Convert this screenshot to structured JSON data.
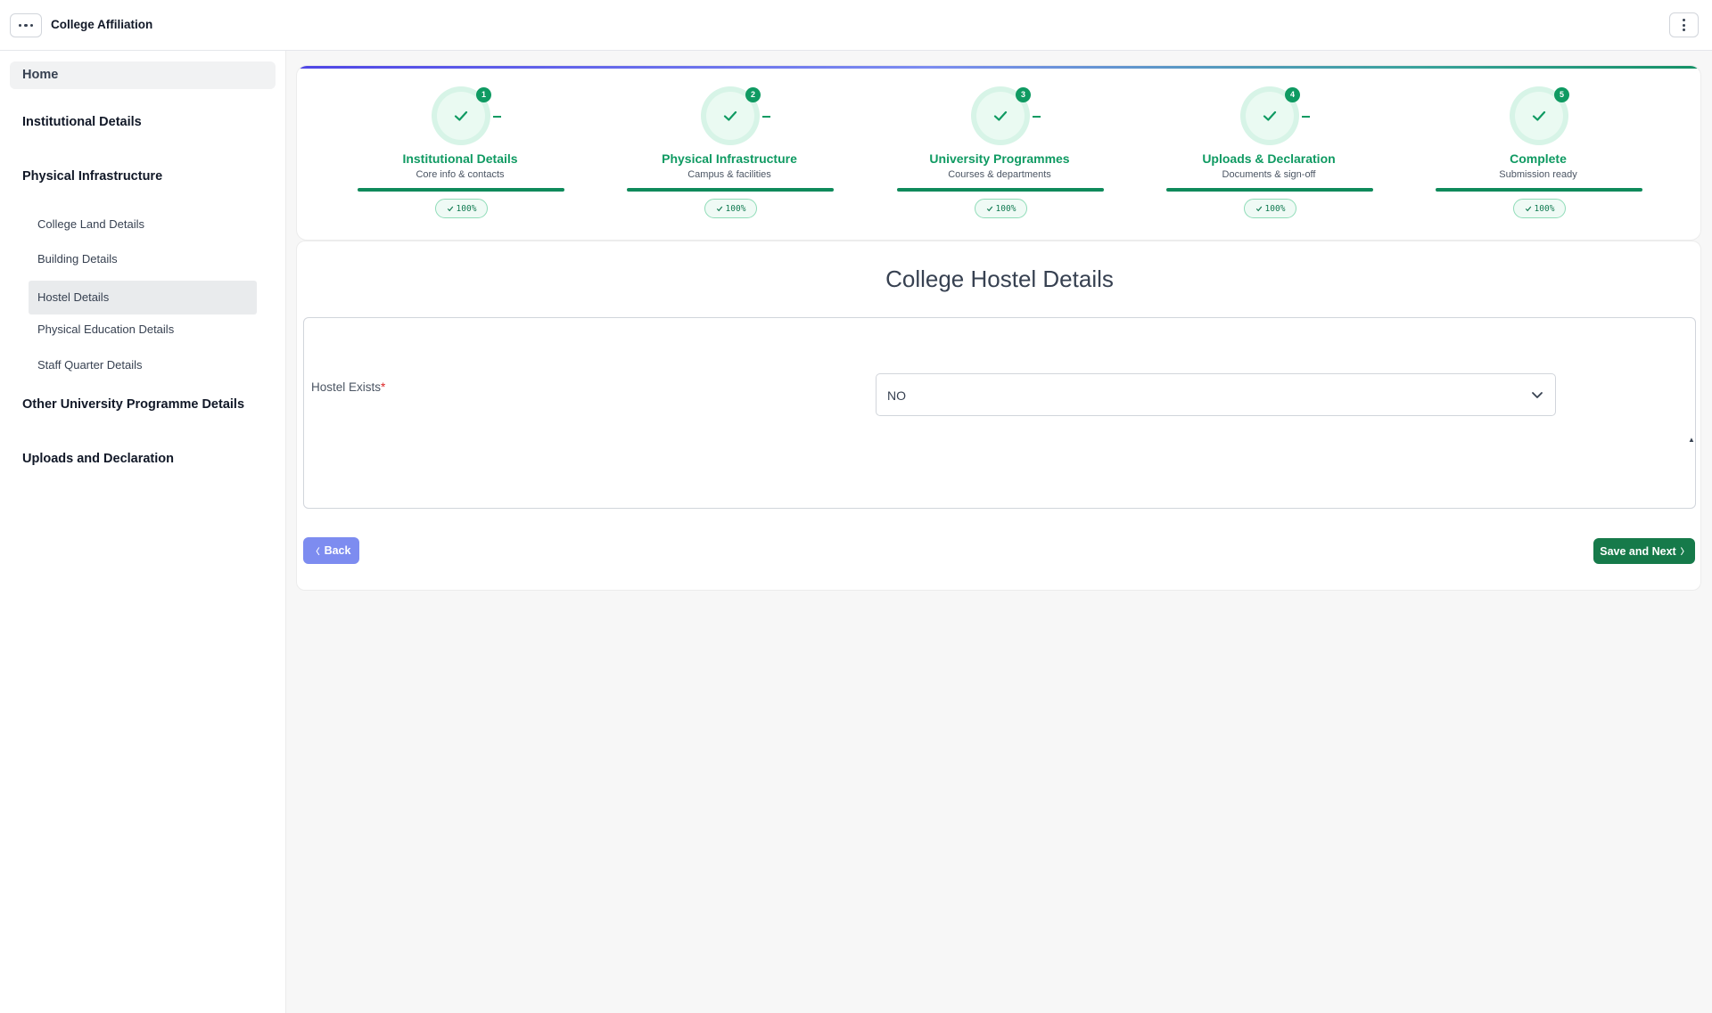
{
  "app": {
    "title": "College Affiliation"
  },
  "sidebar": {
    "home": "Home",
    "sections": [
      {
        "label": "Institutional Details"
      },
      {
        "label": "Physical Infrastructure",
        "items": [
          {
            "label": "College Land Details"
          },
          {
            "label": "Building Details"
          },
          {
            "label": "Hostel Details",
            "active": true
          },
          {
            "label": "Physical Education Details"
          },
          {
            "label": "Staff Quarter Details"
          }
        ]
      },
      {
        "label": "Other University Programme Details"
      },
      {
        "label": "Uploads and Declaration"
      }
    ]
  },
  "stepper": {
    "steps": [
      {
        "number": "1",
        "label": "Institutional Details",
        "sub": "Core info & contacts",
        "progress": "100%"
      },
      {
        "number": "2",
        "label": "Physical Infrastructure",
        "sub": "Campus & facilities",
        "progress": "100%"
      },
      {
        "number": "3",
        "label": "University Programmes",
        "sub": "Courses & departments",
        "progress": "100%"
      },
      {
        "number": "4",
        "label": "Uploads & Declaration",
        "sub": "Documents & sign-off",
        "progress": "100%"
      },
      {
        "number": "5",
        "label": "Complete",
        "sub": "Submission ready",
        "progress": "100%"
      }
    ]
  },
  "form": {
    "title": "College Hostel Details",
    "hostel_exists": {
      "label": "Hostel Exists",
      "required_mark": "*",
      "value": "NO"
    },
    "back_label": "Back",
    "back_glyph": "〈",
    "next_label": "Save and Next",
    "next_glyph": "〉"
  },
  "colors": {
    "accent_green": "#0f9a62",
    "button_green": "#167a4a",
    "back_blue": "#7d8cf0"
  }
}
